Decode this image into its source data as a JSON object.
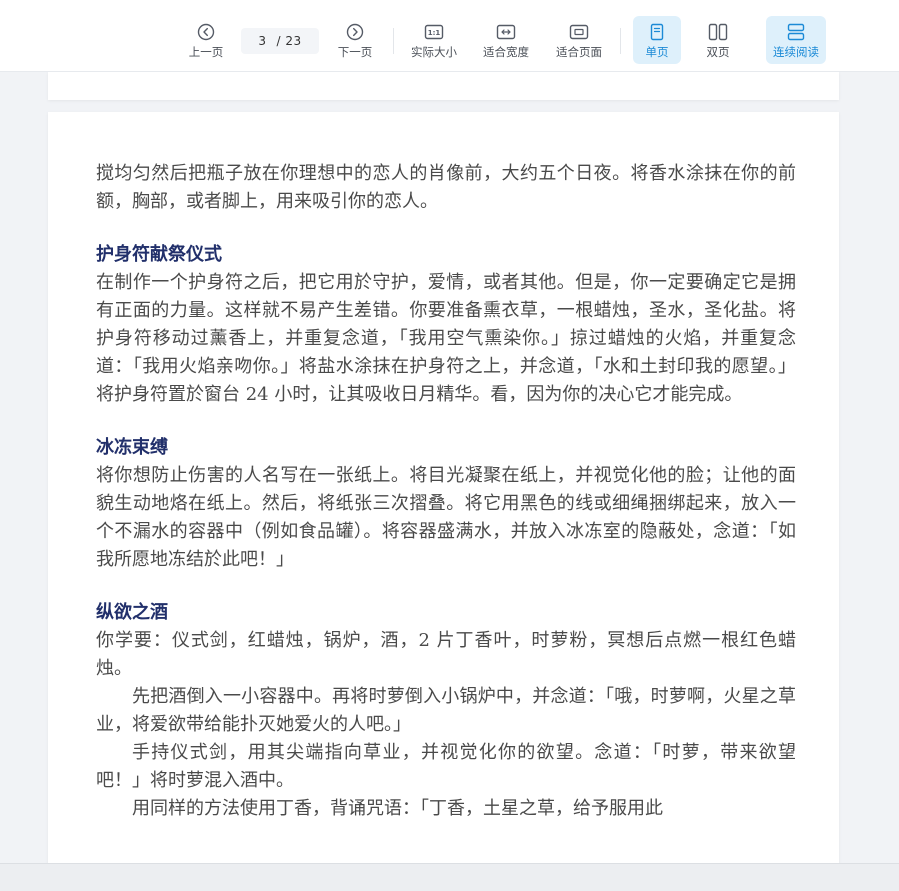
{
  "toolbar": {
    "prev_label": "上一页",
    "current_page": "3",
    "total_pages": "/ 23",
    "next_label": "下一页",
    "actual_size_label": "实际大小",
    "actual_size_icon_text": "1:1",
    "fit_width_label": "适合宽度",
    "fit_page_label": "适合页面",
    "single_page_label": "单页",
    "double_page_label": "双页",
    "continuous_label": "连续阅读",
    "accent_color": "#1b8ad6",
    "active_bg": "#def0fb"
  },
  "document": {
    "para1": "搅均匀然后把瓶子放在你理想中的恋人的肖像前，大约五个日夜。将香水涂抹在你的前额，胸部，或者脚上，用来吸引你的恋人。",
    "heading1": "护身符献祭仪式",
    "para2": "在制作一个护身符之后，把它用於守护，爱情，或者其他。但是，你一定要确定它是拥有正面的力量。这样就不易产生差错。你要准备熏衣草，一根蜡烛，圣水，圣化盐。将护身符移动过薰香上，并重复念道，「我用空气熏染你。」掠过蜡烛的火焰，并重复念道：「我用火焰亲吻你。」将盐水涂抹在护身符之上，并念道，「水和土封印我的愿望。」将护身符置於窗台 24 小时，让其吸收日月精华。看，因为你的决心它才能完成。",
    "heading2": "冰冻束缚",
    "para3": "将你想防止伤害的人名写在一张纸上。将目光凝聚在纸上，并视觉化他的脸；让他的面貌生动地烙在纸上。然后，将纸张三次摺叠。将它用黑色的线或细绳捆绑起来，放入一个不漏水的容器中（例如食品罐）。将容器盛满水，并放入冰冻室的隐蔽处，念道：「如我所愿地冻结於此吧！」",
    "heading3": "纵欲之酒",
    "para4": "你学要：仪式剑，红蜡烛，锅炉，酒，2 片丁香叶，时萝粉，冥想后点燃一根红色蜡烛。",
    "para5": "先把酒倒入一小容器中。再将时萝倒入小锅炉中，并念道：「哦，时萝啊，火星之草业，将爱欲带给能扑灭她爱火的人吧。」",
    "para6": "手持仪式剑，用其尖端指向草业，并视觉化你的欲望。念道：「时萝，带来欲望吧！」将时萝混入酒中。",
    "para7": "用同样的方法使用丁香，背诵咒语：「丁香，土星之草，给予服用此"
  }
}
